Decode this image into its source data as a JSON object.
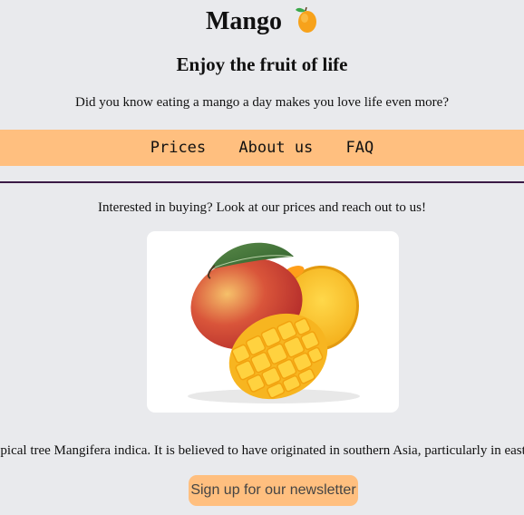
{
  "header": {
    "title": "Mango",
    "subtitle": "Enjoy the fruit of life",
    "tagline": "Did you know eating a mango a day makes you love life even more?"
  },
  "nav": {
    "items": [
      "Prices",
      "About us",
      "FAQ"
    ]
  },
  "main": {
    "interest_text": "Interested in buying? Look at our prices and reach out to us!",
    "fact_text": "A mango is an edible stone fruit produced by the tropical tree Mangifera indica. It is believed to have originated in southern Asia, particularly in eastern India, Burma, and the Andaman Islands.",
    "newsletter_button": "Sign up for our newsletter"
  },
  "colors": {
    "background": "#e9eaed",
    "accent": "#ffbf7f",
    "divider": "#3b1a45"
  },
  "icons": [
    "mango-emoji-icon"
  ]
}
